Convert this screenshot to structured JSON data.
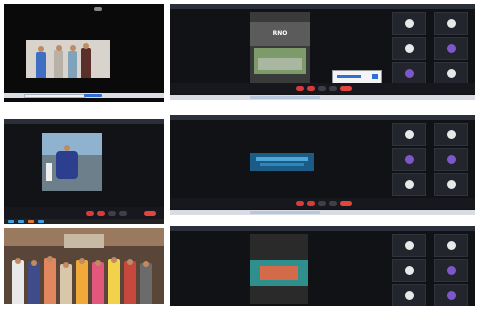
{
  "screens": [
    {
      "id": "s1",
      "topbar_title": ""
    },
    {
      "id": "s2",
      "topbar_title": "",
      "presenter_label": "RNO"
    },
    {
      "id": "s3",
      "topbar_title": ""
    },
    {
      "id": "s4",
      "topbar_title": ""
    },
    {
      "id": "s6",
      "topbar_title": ""
    }
  ],
  "participants": {
    "tile_names": [
      "",
      "",
      "",
      "",
      "",
      "",
      "",
      "",
      "",
      ""
    ]
  },
  "colors": {
    "meet_dark": "#0a0a0a",
    "end_call_red": "#e2453c",
    "avatar_purple": "#7b57c9",
    "avatar_white": "#e8e8e8",
    "taskbar": "#d9dde3"
  },
  "icons": [
    "camera-icon",
    "mic-icon",
    "end-call-icon",
    "chat-icon",
    "people-icon",
    "more-icon"
  ]
}
